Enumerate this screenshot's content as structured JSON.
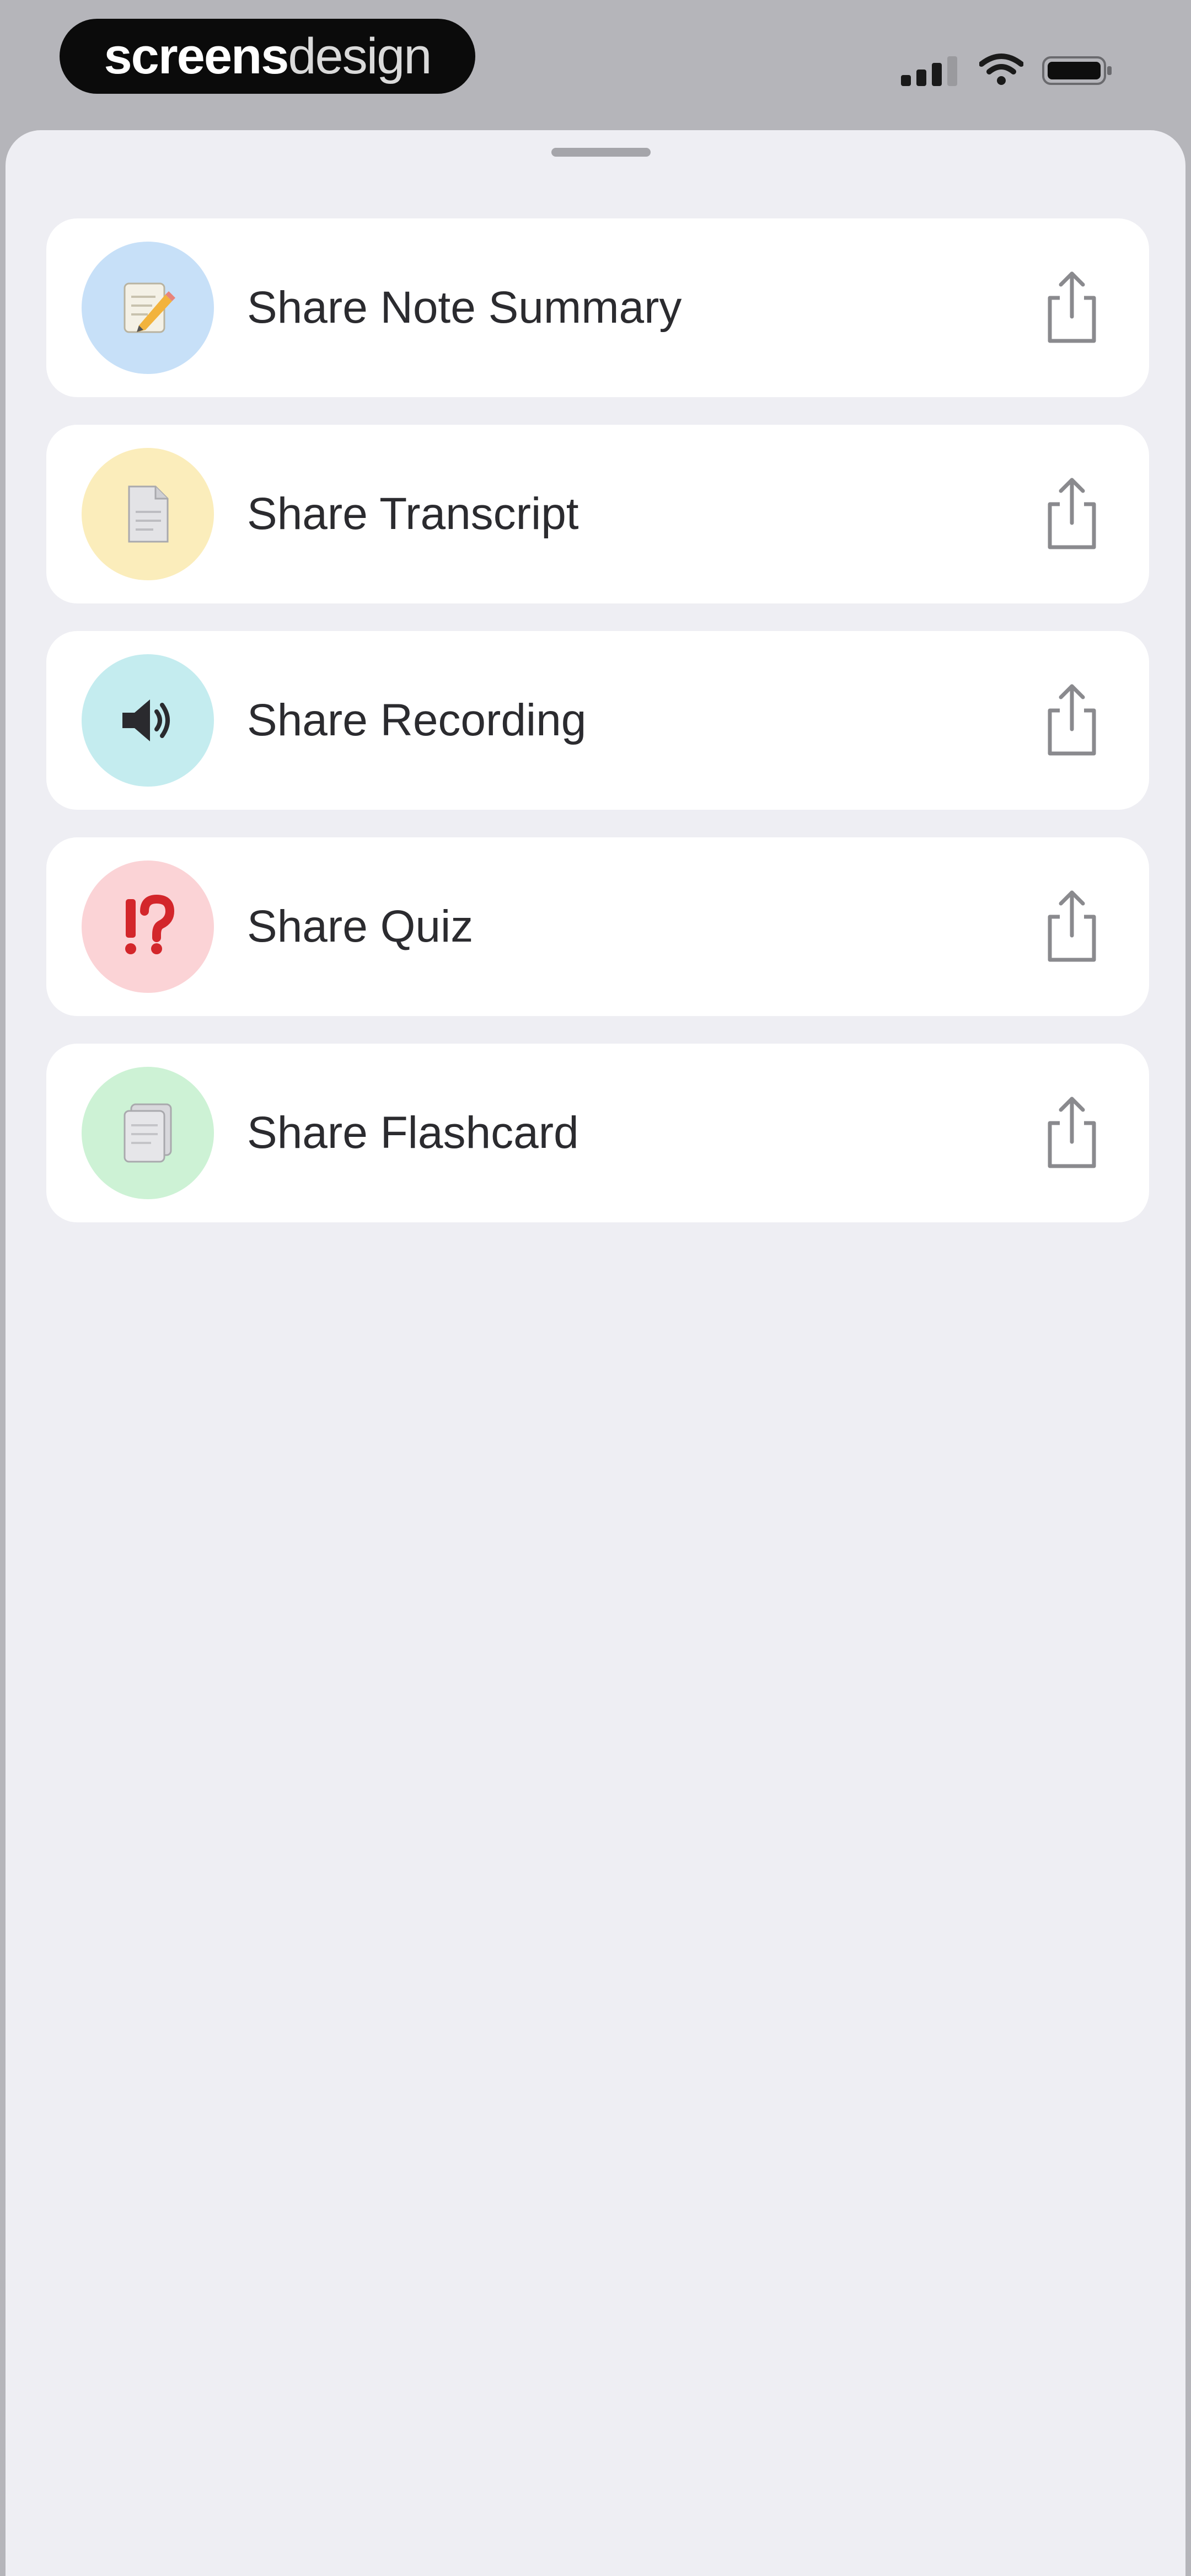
{
  "watermark": {
    "bold": "screens",
    "light": "design"
  },
  "status": {
    "signal_icon": "cellular-signal-icon",
    "wifi_icon": "wifi-icon",
    "battery_icon": "battery-icon"
  },
  "share_options": [
    {
      "label": "Share Note Summary",
      "icon": "memo-pencil-icon",
      "circle_color": "#c7e0f8",
      "action_icon": "share-icon"
    },
    {
      "label": "Share Transcript",
      "icon": "document-icon",
      "circle_color": "#fbedbb",
      "action_icon": "share-icon"
    },
    {
      "label": "Share Recording",
      "icon": "speaker-icon",
      "circle_color": "#c4ecef",
      "action_icon": "share-icon"
    },
    {
      "label": "Share Quiz",
      "icon": "exclamation-question-icon",
      "circle_color": "#fbd3d6",
      "action_icon": "share-icon"
    },
    {
      "label": "Share Flashcard",
      "icon": "flashcard-icon",
      "circle_color": "#cdf2d5",
      "action_icon": "share-icon"
    }
  ]
}
